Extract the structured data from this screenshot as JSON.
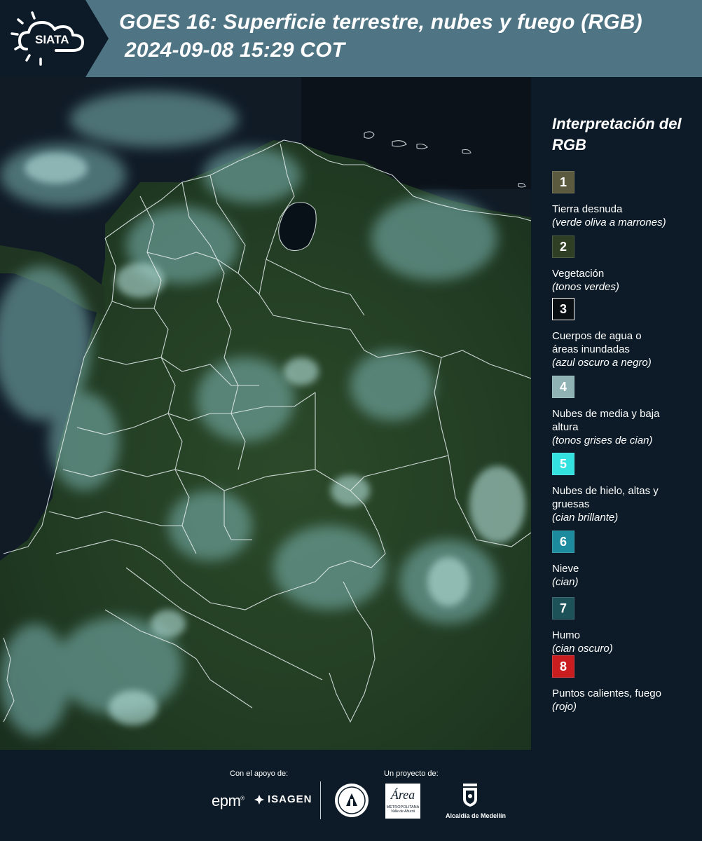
{
  "header": {
    "logo_text": "SIATA",
    "title_line1": "GOES 16: Superficie terrestre, nubes y fuego (RGB)",
    "title_line2": "2024-09-08 15:29 COT",
    "colors": {
      "bar": "#4f7584",
      "logo_block": "#0c1b27"
    }
  },
  "legend": {
    "title": "Interpretación del RGB",
    "items": [
      {
        "number": "1",
        "label": "Tierra desnuda",
        "desc": "(verde oliva a marrones)",
        "color": "#5b5a3e"
      },
      {
        "number": "2",
        "label": "Vegetación",
        "desc": "(tonos verdes)",
        "color": "#2f3f24"
      },
      {
        "number": "3",
        "label": "Cuerpos de agua o áreas inundadas",
        "desc": "(azul oscuro a negro)",
        "color": "#0a0f14"
      },
      {
        "number": "4",
        "label": "Nubes de media y baja altura",
        "desc": "(tonos grises de cian)",
        "color": "#8fb3b5"
      },
      {
        "number": "5",
        "label": "Nubes de hielo, altas y gruesas",
        "desc": "(cian brillante)",
        "color": "#33e1de"
      },
      {
        "number": "6",
        "label": "Nieve",
        "desc": "(cian)",
        "color": "#1c8b9e"
      },
      {
        "number": "7",
        "label": "Humo",
        "desc": "(cian oscuro)",
        "color": "#1d5258"
      },
      {
        "number": "8",
        "label": "Puntos calientes, fuego",
        "desc": "(rojo)",
        "color": "#c91d20"
      }
    ]
  },
  "footer": {
    "support_label": "Con el apoyo de:",
    "project_label": "Un proyecto de:",
    "sponsor_epm": "epm",
    "sponsor_isagen": "ISAGEN",
    "partner_area_name": "Área",
    "partner_area_sub1": "METROPOLITANA",
    "partner_area_sub2": "Valle de Aburrá",
    "partner_medellin": "Alcaldía de Medellín"
  }
}
